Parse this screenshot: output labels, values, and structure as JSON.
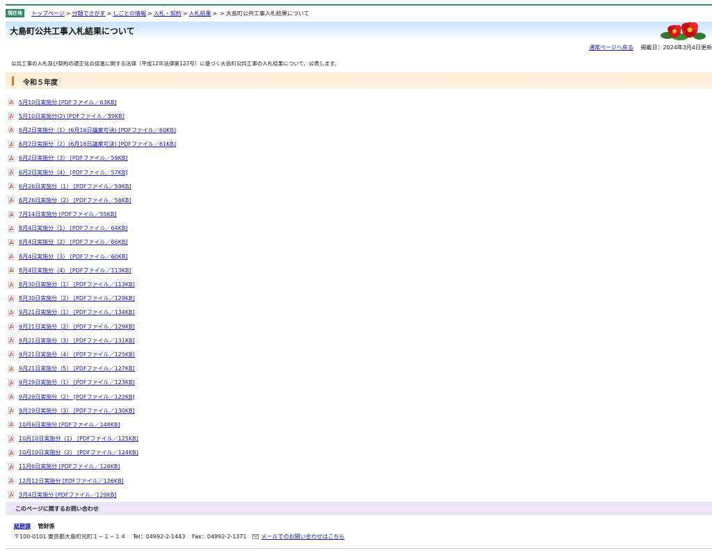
{
  "breadcrumb": {
    "badge": "現在地",
    "items": [
      "トップページ",
      "分類でさがす",
      "しごとの情報",
      "入札・契約",
      "入札結果"
    ],
    "separator": ">",
    "current": "大島町公共工事入札結果について"
  },
  "page": {
    "title": "大島町公共工事入札結果について",
    "normal_page_link": "通常ページへ戻る",
    "posted_date": "掲載日：2024年3月4日更新",
    "intro": "公共工事の入札及び契約の適正化の促進に関する法律（平成12年法律第127号）に基づく大島町公共工事の入札結果について、公表します。"
  },
  "section": {
    "title": "令和５年度",
    "files": [
      "5月10日実施分 [PDFファイル／63KB]",
      "5月10日実施分(2) [PDFファイル／59KB]",
      "6月2日実施分（1）(6月16日議案可決) [PDFファイル／60KB]",
      "6月2日実施分（2）(6月16日議案可決) [PDFファイル／61KB]",
      "6月2日実施分（3） [PDFファイル／59KB]",
      "6月2日実施分（4） [PDFファイル／57KB]",
      "6月26日実施分（1） [PDFファイル／59KB]",
      "6月26日実施分（2） [PDFファイル／56KB]",
      "7月14日実施分 [PDFファイル／55KB]",
      "8月4日実施分（1） [PDFファイル／64KB]",
      "8月4日実施分（2） [PDFファイル／66KB]",
      "8月4日実施分（3） [PDFファイル／60KB]",
      "8月4日実施分（4） [PDFファイル／113KB]",
      "8月30日実施分（1） [PDFファイル／113KB]",
      "8月30日実施分（2） [PDFファイル／129KB]",
      "9月21日実施分（1） [PDFファイル／134KB]",
      "9月21日実施分（2） [PDFファイル／129KB]",
      "9月21日実施分（3） [PDFファイル／131KB]",
      "9月21日実施分（4） [PDFファイル／125KB]",
      "9月21日実施分（5） [PDFファイル／127KB]",
      "9月29日実施分（1） [PDFファイル／123KB]",
      "9月29日実施分（2） [PDFファイル／122KB]",
      "9月29日実施分（3） [PDFファイル／130KB]",
      "10月6日実施分 [PDFファイル／148KB]",
      "10月10日実施分（1） [PDFファイル／125KB]",
      "10月10日実施分（2） [PDFファイル／124KB]",
      "11月6日実施分 [PDFファイル／126KB]",
      "12月12日実施分 [PDFファイル／126KB]",
      "3月4日実施分 [PDFファイル／129KB]"
    ]
  },
  "contact": {
    "heading": "このページに関するお問い合わせ",
    "dept_link": "総務課",
    "unit": "管財係",
    "address": "〒100-0101 東京都大島町元町１－１－１４",
    "tel": "Tel：04992-2-1443",
    "fax": "Fax：04992-2-1371",
    "mail_link": "メールでのお問い合わせはこちら"
  },
  "icons": {
    "file": "pdf-icon",
    "mail": "mail-icon",
    "decoration": "camellia-flower-icon"
  },
  "colors": {
    "accent_green": "#2d8a5f",
    "title_blue": "#c9e2ff",
    "section_orange": "#e0780a",
    "link": "#1a1aa6",
    "contact_purple": "#ebe6f6"
  }
}
